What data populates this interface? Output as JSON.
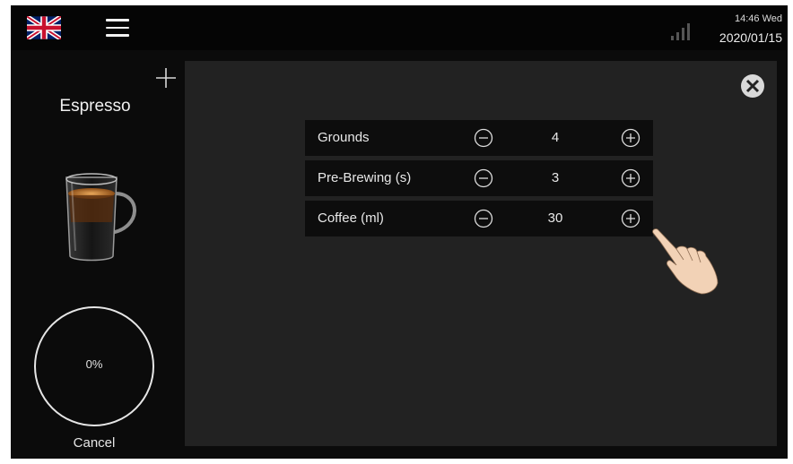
{
  "status_bar": {
    "time_day": "14:46 Wed",
    "date": "2020/01/15"
  },
  "sidebar": {
    "product_name": "Espresso",
    "progress": "0%",
    "cancel_label": "Cancel"
  },
  "settings": {
    "rows": [
      {
        "label": "Grounds",
        "value": "4"
      },
      {
        "label": "Pre-Brewing (s)",
        "value": "3"
      },
      {
        "label": "Coffee (ml)",
        "value": "30"
      }
    ]
  },
  "icons": [
    "uk-flag-icon",
    "menu-icon",
    "signal-icon",
    "plus-icon",
    "close-icon",
    "minus-icon",
    "plus-icon",
    "hand-pointer-icon"
  ],
  "colors": {
    "background": "#0b0b0b",
    "panel": "#222222",
    "row": "#0d0d0d",
    "text": "#e8e8e8"
  }
}
